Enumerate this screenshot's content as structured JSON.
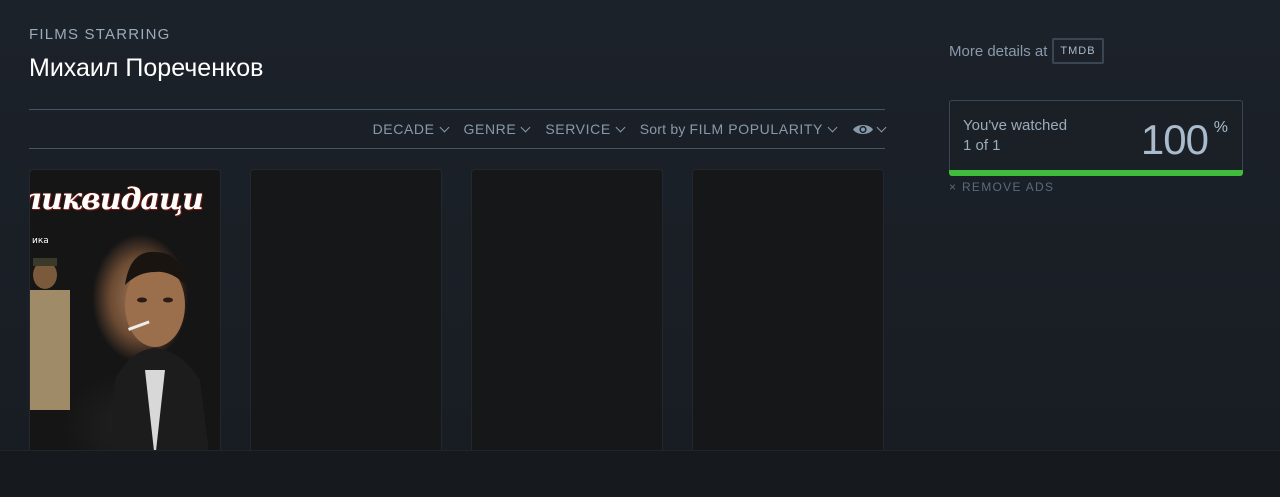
{
  "header": {
    "kicker": "FILMS STARRING",
    "actor_name": "Михаил Пореченков"
  },
  "filters": {
    "decade": "DECADE",
    "genre": "GENRE",
    "service": "SERVICE",
    "sort_prefix": "Sort by",
    "sort_value": "FILM POPULARITY"
  },
  "posters": [
    {
      "title_text": "ликвидаци",
      "corner_text": "ика",
      "filled": true
    },
    {
      "filled": false
    },
    {
      "filled": false
    },
    {
      "filled": false
    }
  ],
  "sidebar": {
    "details_label": "More details at",
    "tmdb_label": "TMDB",
    "watched_label": "You've watched",
    "watched_count": "1 of 1",
    "watched_percent": "100",
    "percent_sign": "%",
    "progress_fraction": 1.0,
    "remove_ads": "REMOVE ADS",
    "remove_icon": "×"
  },
  "colors": {
    "progress": "#40bc3c",
    "background": "#1c222a"
  },
  "icons": {
    "eye": "eye-icon",
    "chevron": "chevron-down-icon",
    "close": "close-icon"
  }
}
